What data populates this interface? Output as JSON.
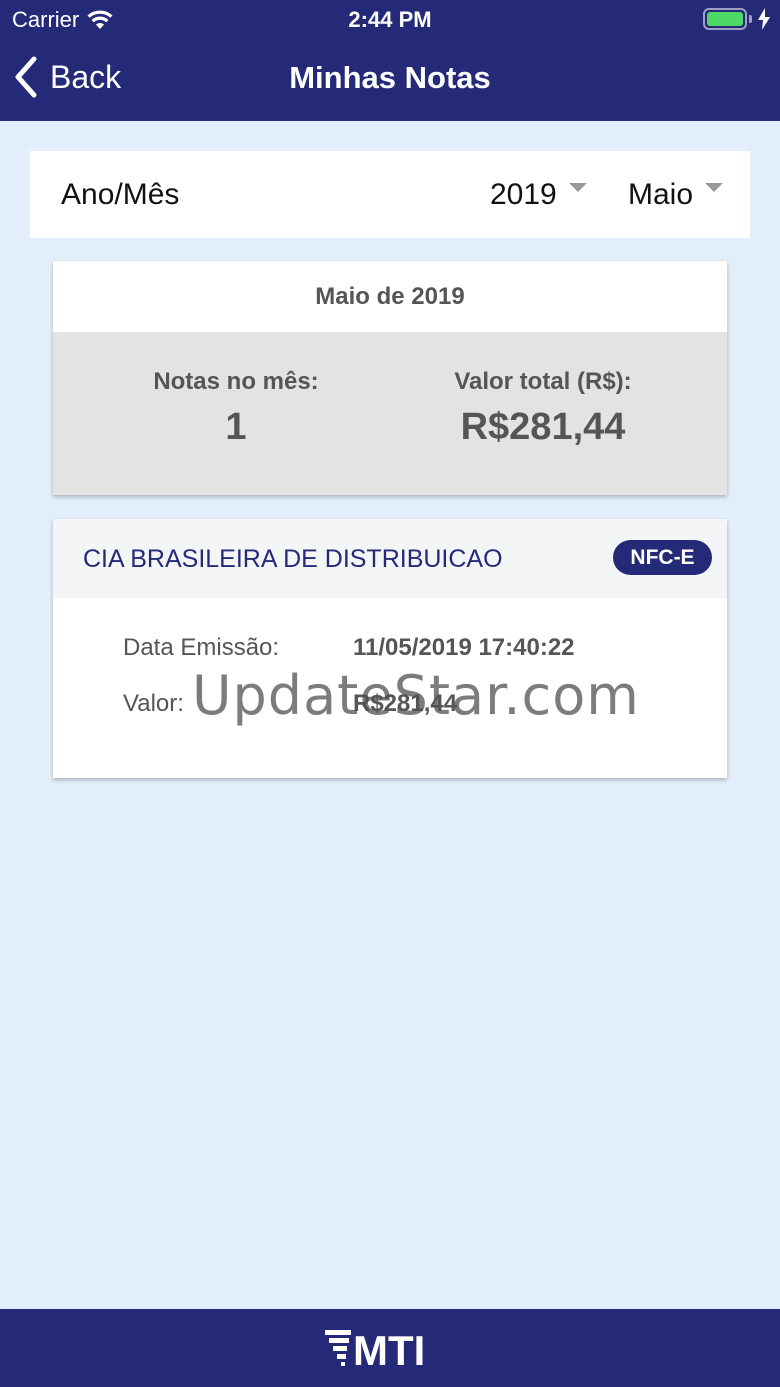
{
  "status_bar": {
    "carrier": "Carrier",
    "time": "2:44 PM"
  },
  "nav": {
    "back_label": "Back",
    "title": "Minhas Notas"
  },
  "filter": {
    "label": "Ano/Mês",
    "year": "2019",
    "month": "Maio"
  },
  "summary": {
    "heading": "Maio de 2019",
    "notes_label": "Notas no mês:",
    "notes_value": "1",
    "total_label": "Valor total (R$):",
    "total_value": "R$281,44"
  },
  "notes": [
    {
      "company": "CIA BRASILEIRA DE DISTRIBUICAO",
      "badge": "NFC-E",
      "date_label": "Data Emissão:",
      "date_value": "11/05/2019 17:40:22",
      "value_label": "Valor:",
      "value": "R$281,44"
    }
  ],
  "watermark": "UpdateStar.com",
  "footer": {
    "logo_text": "MTI"
  },
  "colors": {
    "primary": "#242a78",
    "background": "#e2eef9",
    "battery": "#4cd964"
  }
}
